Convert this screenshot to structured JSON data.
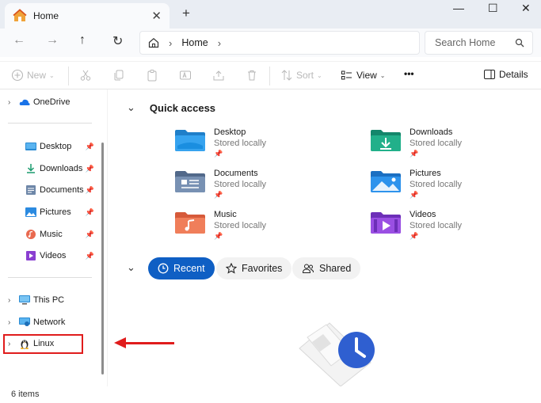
{
  "titlebar": {
    "tab_title": "Home",
    "close_tab": "✕",
    "new_tab": "+",
    "minimize": "—",
    "maximize": "☐",
    "close": "✕"
  },
  "navbar": {
    "back": "←",
    "forward": "→",
    "up": "↑",
    "refresh": "↻",
    "breadcrumb_sep": "›",
    "location": "Home",
    "search_placeholder": "Search Home"
  },
  "toolbar": {
    "new": "New",
    "sort": "Sort",
    "view": "View",
    "more": "•••",
    "details": "Details"
  },
  "sidebar": {
    "onedrive": "OneDrive",
    "pinned": [
      {
        "label": "Desktop"
      },
      {
        "label": "Downloads"
      },
      {
        "label": "Documents"
      },
      {
        "label": "Pictures"
      },
      {
        "label": "Music"
      },
      {
        "label": "Videos"
      }
    ],
    "this_pc": "This PC",
    "network": "Network",
    "linux": "Linux"
  },
  "main": {
    "quick_access_title": "Quick access",
    "quick_access": [
      {
        "name": "Desktop",
        "sub": "Stored locally"
      },
      {
        "name": "Downloads",
        "sub": "Stored locally"
      },
      {
        "name": "Documents",
        "sub": "Stored locally"
      },
      {
        "name": "Pictures",
        "sub": "Stored locally"
      },
      {
        "name": "Music",
        "sub": "Stored locally"
      },
      {
        "name": "Videos",
        "sub": "Stored locally"
      }
    ],
    "tabs": [
      {
        "label": "Recent"
      },
      {
        "label": "Favorites"
      },
      {
        "label": "Shared"
      }
    ]
  },
  "status": {
    "items": "6 items"
  },
  "colors": {
    "accent": "#0f5fc4",
    "annotation": "#e01c1c"
  }
}
